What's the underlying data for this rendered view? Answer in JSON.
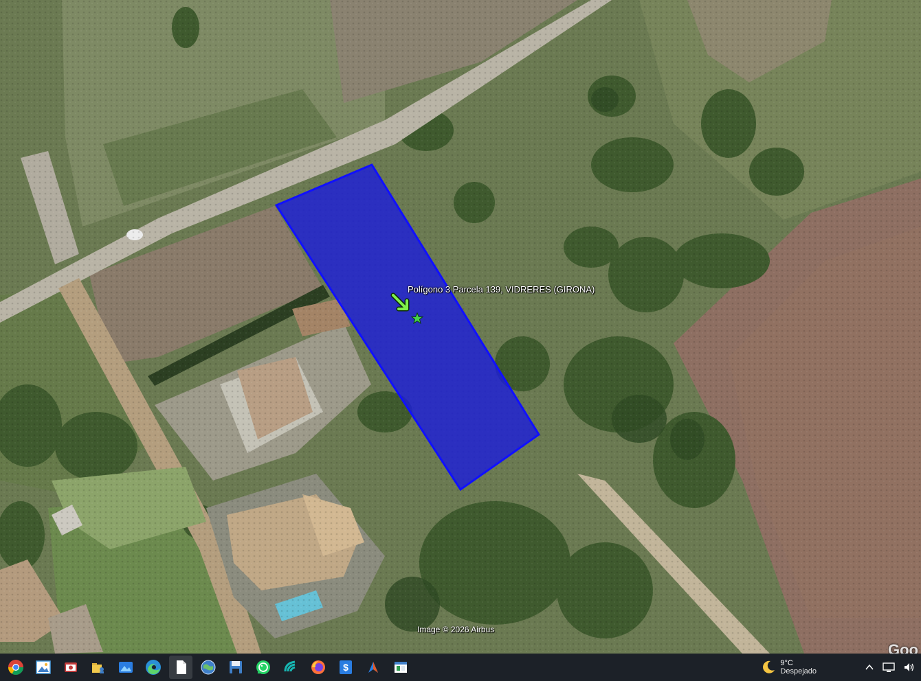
{
  "map": {
    "parcel_label": "Polígono 3 Parcela 139, VIDRERES (GIRONA)",
    "attribution": "Image © 2026 Airbus",
    "logo_partial": "Goo",
    "parcel_fill": "#1a1adf",
    "parcel_stroke": "#1010ff"
  },
  "taskbar": {
    "apps": [
      {
        "name": "chrome-icon"
      },
      {
        "name": "image-viewer-icon"
      },
      {
        "name": "snipping-tool-icon"
      },
      {
        "name": "user-folder-icon"
      },
      {
        "name": "photos-icon"
      },
      {
        "name": "edge-icon"
      },
      {
        "name": "document-icon",
        "active": true
      },
      {
        "name": "google-earth-icon"
      },
      {
        "name": "save-disk-icon"
      },
      {
        "name": "whatsapp-icon"
      },
      {
        "name": "teal-app-icon"
      },
      {
        "name": "firefox-icon"
      },
      {
        "name": "dollar-app-icon"
      },
      {
        "name": "arrow-app-icon"
      },
      {
        "name": "spreadsheet-icon"
      }
    ],
    "weather": {
      "temp": "9°C",
      "condition": "Despejado"
    }
  }
}
